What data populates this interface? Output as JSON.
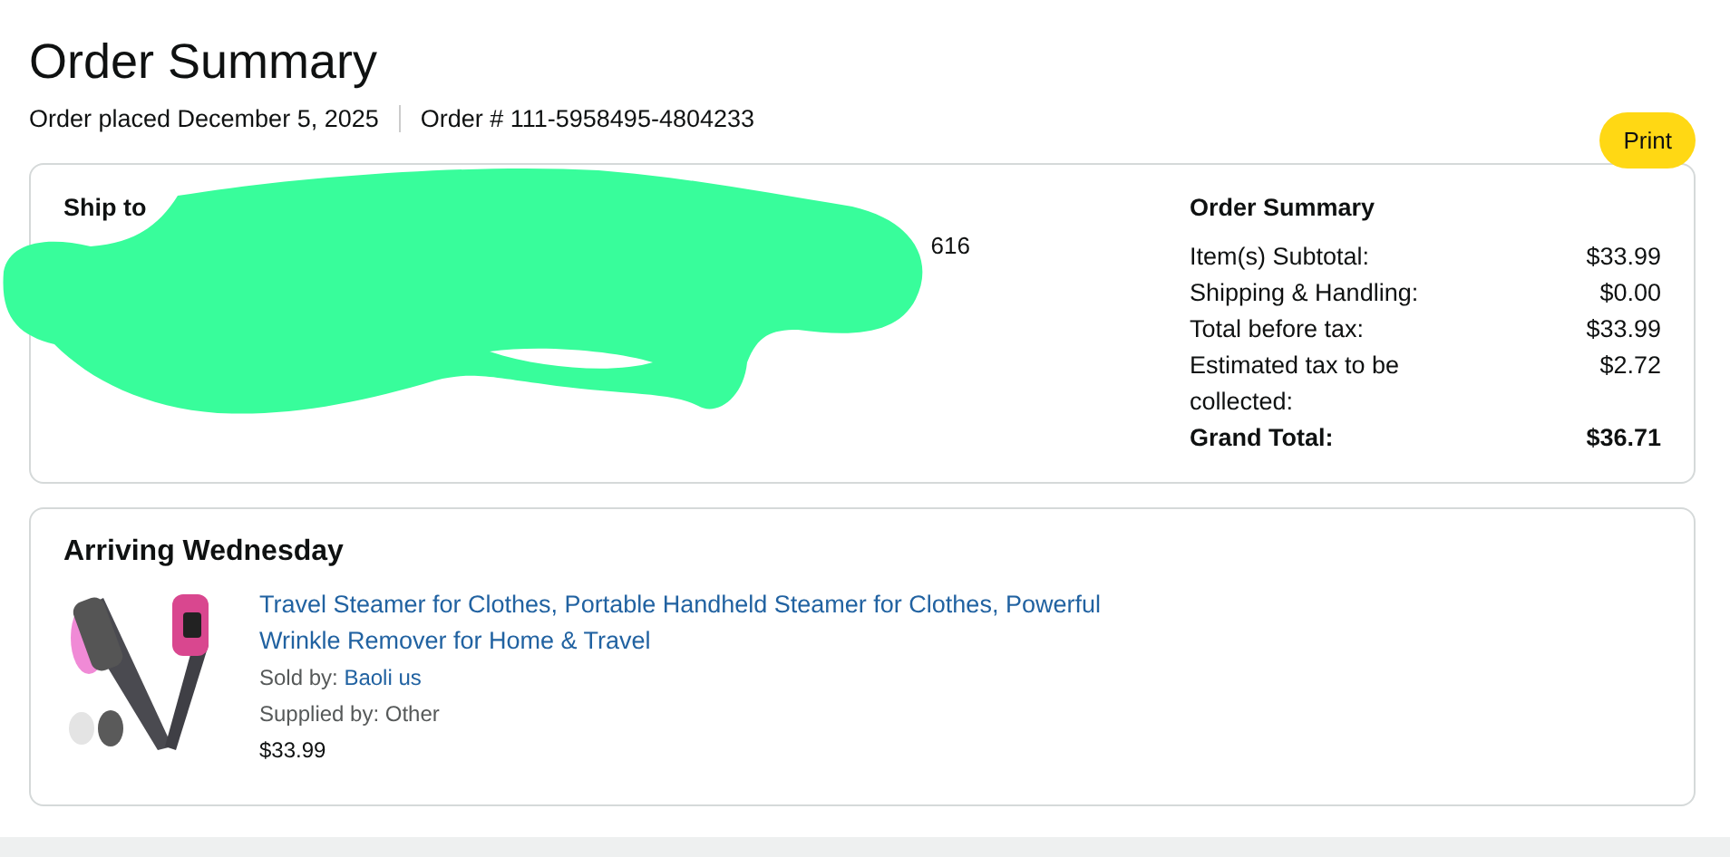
{
  "page": {
    "title": "Order Summary"
  },
  "order_info": {
    "placed": "Order placed December 5, 2025",
    "number": "Order # 111-5958495-4804233"
  },
  "print_button": {
    "label": "Print"
  },
  "shipping": {
    "label": "Ship to",
    "fragment": "616"
  },
  "summary": {
    "heading": "Order Summary",
    "lines": [
      {
        "label": "Item(s) Subtotal:",
        "value": "$33.99",
        "kind": "normal"
      },
      {
        "label": "Shipping & Handling:",
        "value": "$0.00",
        "kind": "normal"
      },
      {
        "label": "Total before tax:",
        "value": "$33.99",
        "kind": "normal"
      },
      {
        "label": "Estimated tax to be collected:",
        "value": "$2.72",
        "kind": "normal"
      },
      {
        "label": "Grand Total:",
        "value": "$36.71",
        "kind": "total"
      }
    ]
  },
  "shipment": {
    "heading": "Arriving Wednesday",
    "items": [
      {
        "title": "Travel Steamer for Clothes, Portable Handheld Steamer for Clothes, Powerful Wrinkle Remover for Home & Travel",
        "sold_by_label": "Sold by:",
        "seller": "Baoli us",
        "supplied": "Supplied by: Other",
        "price": "$33.99"
      }
    ]
  }
}
